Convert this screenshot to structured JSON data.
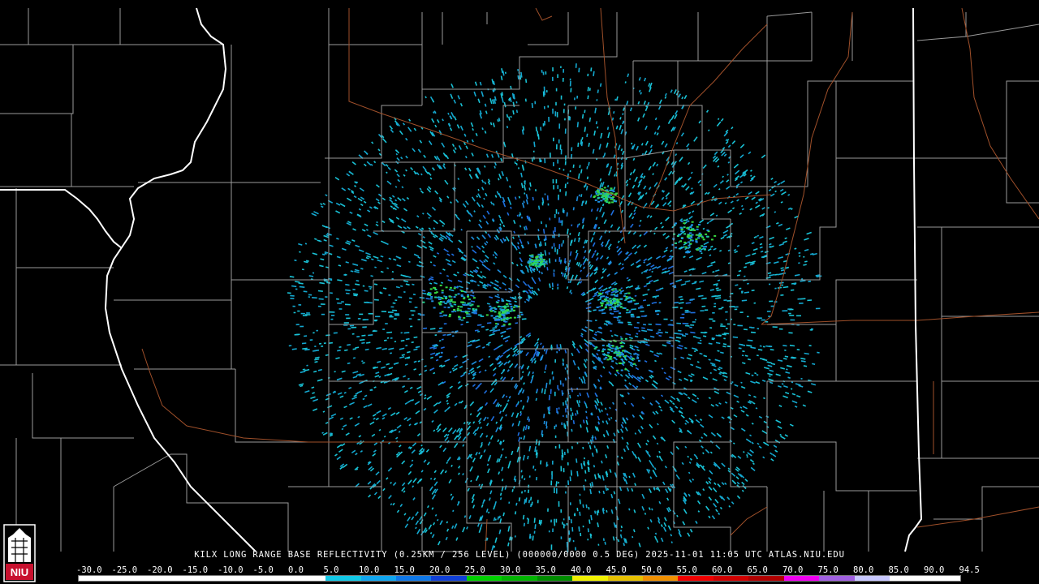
{
  "product": {
    "caption": "KILX LONG RANGE BASE REFLECTIVITY (0.25KM / 256 LEVEL) (000000/0000 0.5 DEG) 2025-11-01 11:05 UTC  ATLAS.NIU.EDU"
  },
  "logo": {
    "text": "NIU",
    "color": "#c8102e"
  },
  "legend": {
    "labels": [
      "-30.0",
      "-25.0",
      "-20.0",
      "-15.0",
      "-10.0",
      "-5.0",
      "0.0",
      "5.0",
      "10.0",
      "15.0",
      "20.0",
      "25.0",
      "30.0",
      "35.0",
      "40.0",
      "45.0",
      "50.0",
      "55.0",
      "60.0",
      "65.0",
      "70.0",
      "75.0",
      "80.0",
      "85.0",
      "90.0",
      "94.5"
    ],
    "colors": [
      "#ffffff",
      "#ffffff",
      "#ffffff",
      "#ffffff",
      "#ffffff",
      "#ffffff",
      "#ffffff",
      "#12c8e6",
      "#10a6f0",
      "#0f78e8",
      "#1040d8",
      "#00d000",
      "#00b400",
      "#008c00",
      "#f0f000",
      "#e6c000",
      "#f09000",
      "#f00000",
      "#d00000",
      "#b00000",
      "#f000f0",
      "#a060e0",
      "#c8c8ff",
      "#ffffff",
      "#ffffff"
    ]
  },
  "colors": {
    "background": "#000000",
    "county_border": "#9a9a9a",
    "state_border": "#ffffff",
    "highway": "#a0502a"
  },
  "radar": {
    "site": "KILX",
    "echo_colors": [
      "#19c2d6",
      "#14a8d0",
      "#1d8fe0",
      "#1f6fe0",
      "#1fd08a",
      "#38d640"
    ]
  }
}
